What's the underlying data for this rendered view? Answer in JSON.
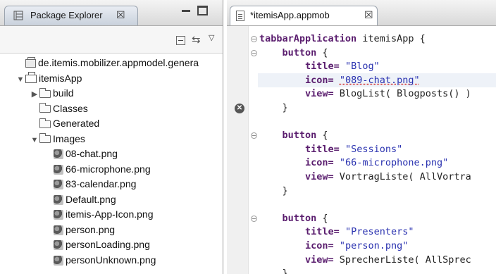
{
  "package_explorer": {
    "title": "Package Explorer",
    "close_glyph": "☒",
    "tree": [
      {
        "label": "de.itemis.mobilizer.appmodel.genera",
        "icon": "jar-icon",
        "twisty": "",
        "indent": 0
      },
      {
        "label": "itemisApp",
        "icon": "project-icon",
        "twisty": "▼",
        "indent": 0
      },
      {
        "label": "build",
        "icon": "folder-icon",
        "twisty": "▶",
        "indent": 1
      },
      {
        "label": "Classes",
        "icon": "folder-icon",
        "twisty": "",
        "indent": 1
      },
      {
        "label": "Generated",
        "icon": "folder-icon",
        "twisty": "",
        "indent": 1
      },
      {
        "label": "Images",
        "icon": "folder-icon",
        "twisty": "▼",
        "indent": 1
      },
      {
        "label": "08-chat.png",
        "icon": "image-file-icon",
        "twisty": "",
        "indent": 2
      },
      {
        "label": "66-microphone.png",
        "icon": "image-file-icon",
        "twisty": "",
        "indent": 2
      },
      {
        "label": "83-calendar.png",
        "icon": "image-file-icon",
        "twisty": "",
        "indent": 2
      },
      {
        "label": "Default.png",
        "icon": "image-file-icon",
        "twisty": "",
        "indent": 2
      },
      {
        "label": "itemis-App-Icon.png",
        "icon": "image-file-icon",
        "twisty": "",
        "indent": 2
      },
      {
        "label": "person.png",
        "icon": "image-file-icon",
        "twisty": "",
        "indent": 2
      },
      {
        "label": "personLoading.png",
        "icon": "image-file-icon",
        "twisty": "",
        "indent": 2
      },
      {
        "label": "personUnknown.png",
        "icon": "image-file-icon",
        "twisty": "",
        "indent": 2
      }
    ]
  },
  "editor": {
    "tab_label": "*itemisApp.appmob",
    "close_glyph": "☒",
    "error_marker": "✕",
    "lines": [
      [
        {
          "t": "tabbarApplication",
          "k": "kw"
        },
        {
          "t": " itemisApp {",
          "k": ""
        }
      ],
      [
        {
          "t": "    ",
          "k": ""
        },
        {
          "t": "button",
          "k": "kw"
        },
        {
          "t": " {",
          "k": ""
        }
      ],
      [
        {
          "t": "        ",
          "k": ""
        },
        {
          "t": "title=",
          "k": "kw"
        },
        {
          "t": " ",
          "k": ""
        },
        {
          "t": "\"Blog\"",
          "k": "str"
        }
      ],
      [
        {
          "t": "        ",
          "k": ""
        },
        {
          "t": "icon=",
          "k": "kw"
        },
        {
          "t": " ",
          "k": ""
        },
        {
          "t": "\"089-chat.png\"",
          "k": "str err"
        }
      ],
      [
        {
          "t": "        ",
          "k": ""
        },
        {
          "t": "view=",
          "k": "kw"
        },
        {
          "t": " BlogList( Blogposts() )",
          "k": ""
        }
      ],
      [
        {
          "t": "    }",
          "k": ""
        }
      ],
      [
        {
          "t": "",
          "k": ""
        }
      ],
      [
        {
          "t": "    ",
          "k": ""
        },
        {
          "t": "button",
          "k": "kw"
        },
        {
          "t": " {",
          "k": ""
        }
      ],
      [
        {
          "t": "        ",
          "k": ""
        },
        {
          "t": "title=",
          "k": "kw"
        },
        {
          "t": " ",
          "k": ""
        },
        {
          "t": "\"Sessions\"",
          "k": "str"
        }
      ],
      [
        {
          "t": "        ",
          "k": ""
        },
        {
          "t": "icon=",
          "k": "kw"
        },
        {
          "t": " ",
          "k": ""
        },
        {
          "t": "\"66-microphone.png\"",
          "k": "str"
        }
      ],
      [
        {
          "t": "        ",
          "k": ""
        },
        {
          "t": "view=",
          "k": "kw"
        },
        {
          "t": " VortragListe( AllVortra",
          "k": ""
        }
      ],
      [
        {
          "t": "    }",
          "k": ""
        }
      ],
      [
        {
          "t": "",
          "k": ""
        }
      ],
      [
        {
          "t": "    ",
          "k": ""
        },
        {
          "t": "button",
          "k": "kw"
        },
        {
          "t": " {",
          "k": ""
        }
      ],
      [
        {
          "t": "        ",
          "k": ""
        },
        {
          "t": "title=",
          "k": "kw"
        },
        {
          "t": " ",
          "k": ""
        },
        {
          "t": "\"Presenters\"",
          "k": "str"
        }
      ],
      [
        {
          "t": "        ",
          "k": ""
        },
        {
          "t": "icon=",
          "k": "kw"
        },
        {
          "t": " ",
          "k": ""
        },
        {
          "t": "\"person.png\"",
          "k": "str"
        }
      ],
      [
        {
          "t": "        ",
          "k": ""
        },
        {
          "t": "view=",
          "k": "kw"
        },
        {
          "t": " SprecherListe( AllSprec",
          "k": ""
        }
      ],
      [
        {
          "t": "    }",
          "k": ""
        }
      ]
    ]
  }
}
